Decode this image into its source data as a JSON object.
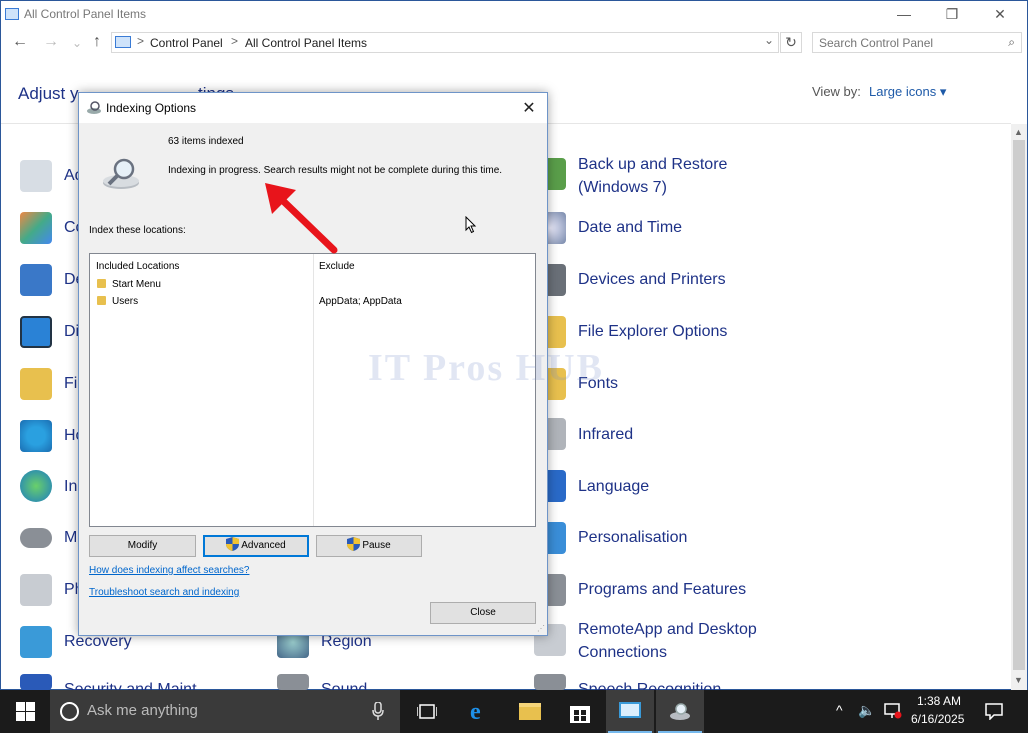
{
  "window": {
    "title": "All Control Panel Items",
    "controls": {
      "minimize": "—",
      "restore": "❐",
      "close": "✕"
    }
  },
  "nav": {
    "back": "←",
    "forward": "→",
    "up": "↑",
    "dropdown": "⌄",
    "refresh": "↻"
  },
  "address": {
    "crumbs": [
      "Control Panel",
      "All Control Panel Items"
    ],
    "separator": ">"
  },
  "search": {
    "placeholder": "Search Control Panel",
    "icon": "⌕"
  },
  "heading": "Adjust y",
  "heading_tail": "tings",
  "view": {
    "label": "View by:",
    "value": "Large icons ▾"
  },
  "items_left": [
    {
      "label": "Ad",
      "icon": "admin-tools-icon"
    },
    {
      "label": "Co",
      "icon": "color-management-icon"
    },
    {
      "label": "De",
      "icon": "default-programs-icon"
    },
    {
      "label": "Di",
      "icon": "display-icon"
    },
    {
      "label": "Fi",
      "icon": "file-history-icon"
    },
    {
      "label": "Ho",
      "icon": "homegroup-icon"
    },
    {
      "label": "In",
      "icon": "internet-options-icon"
    },
    {
      "label": "M",
      "icon": "mouse-icon"
    },
    {
      "label": "Ph",
      "icon": "phone-modem-icon"
    },
    {
      "label": "Recovery",
      "icon": "recovery-icon"
    },
    {
      "label": "Security and Maint",
      "icon": "security-icon"
    }
  ],
  "items_mid": [
    {
      "label": "Region",
      "icon": "region-icon"
    },
    {
      "label": "Sound",
      "icon": "sound-icon"
    }
  ],
  "items_right": [
    {
      "line1": "Back up and Restore",
      "line2": "(Windows 7)",
      "icon": "backup-icon"
    },
    {
      "line1": "Date and Time",
      "line2": "",
      "icon": "date-time-icon"
    },
    {
      "line1": "Devices and Printers",
      "line2": "",
      "icon": "devices-printers-icon"
    },
    {
      "line1": "File Explorer Options",
      "line2": "",
      "icon": "folder-options-icon"
    },
    {
      "line1": "Fonts",
      "line2": "",
      "icon": "fonts-icon"
    },
    {
      "line1": "Infrared",
      "line2": "",
      "icon": "infrared-icon"
    },
    {
      "line1": "Language",
      "line2": "",
      "icon": "language-icon"
    },
    {
      "line1": "Personalisation",
      "line2": "",
      "icon": "personalisation-icon"
    },
    {
      "line1": "Programs and Features",
      "line2": "",
      "icon": "programs-features-icon"
    },
    {
      "line1": "RemoteApp and Desktop",
      "line2": "Connections",
      "icon": "remoteapp-icon"
    },
    {
      "line1": "Speech Recognition",
      "line2": "",
      "icon": "speech-icon"
    }
  ],
  "dialog": {
    "title": "Indexing Options",
    "close": "✕",
    "items_indexed": "63 items indexed",
    "status": "Indexing in progress. Search results might not be complete during this time.",
    "index_label": "Index these locations:",
    "columns": [
      "Included Locations",
      "Exclude"
    ],
    "locations": [
      {
        "name": "Start Menu",
        "exclude": ""
      },
      {
        "name": "Users",
        "exclude": "AppData; AppData"
      }
    ],
    "buttons": {
      "modify": "Modify",
      "advanced": "Advanced",
      "pause": "Pause",
      "close": "Close"
    },
    "links": {
      "how": "How does indexing affect searches?",
      "troubleshoot": "Troubleshoot search and indexing"
    }
  },
  "watermark": "IT Pros HUB",
  "taskbar": {
    "search_placeholder": "Ask me anything",
    "time": "1:38 AM",
    "date": "6/16/2025",
    "tray": {
      "chevron": "^",
      "volume": "🔈"
    }
  },
  "colors": {
    "accent": "#0078d7",
    "link": "#1e3287",
    "arrow": "#e8141b",
    "taskbar": "#1b1b1b"
  }
}
